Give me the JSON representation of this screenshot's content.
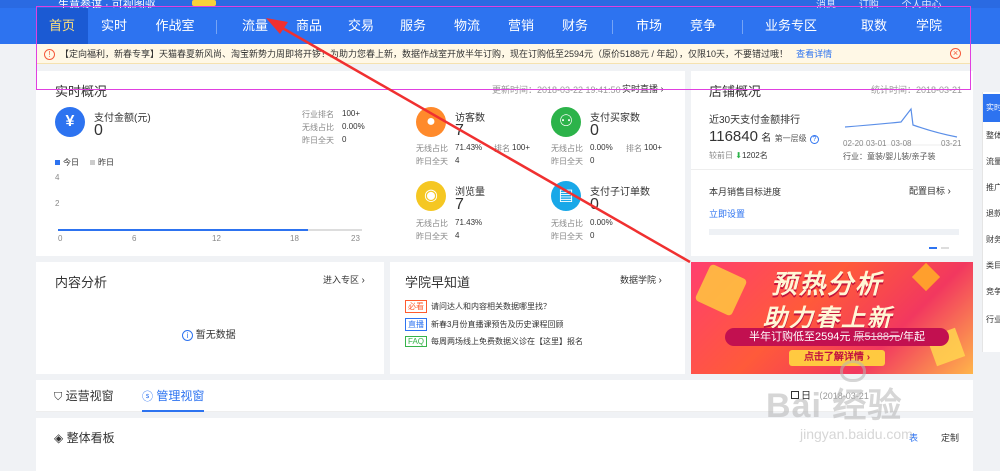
{
  "header": {
    "title_fragment": "生意参谋 · 可视图驱",
    "top_right": [
      "消息",
      "订购",
      "个人中心"
    ],
    "nav": [
      {
        "label": "首页",
        "active": true
      },
      {
        "label": "实时"
      },
      {
        "label": "作战室"
      },
      {
        "label": "流量"
      },
      {
        "label": "商品"
      },
      {
        "label": "交易"
      },
      {
        "label": "服务"
      },
      {
        "label": "物流"
      },
      {
        "label": "营销"
      },
      {
        "label": "财务"
      },
      {
        "label": "市场"
      },
      {
        "label": "竞争"
      },
      {
        "label": "业务专区"
      },
      {
        "label": "取数"
      },
      {
        "label": "学院"
      }
    ]
  },
  "notice": {
    "text": "【定向福利，新春专享】天猫春夏新风尚、淘宝新势力周即将开锣！为助力您春上新，数据作战室开放半年订购，现在订购低至2594元（原价5188元 / 年起），仅限10天，不要错过哦！",
    "link": "查看详情"
  },
  "realtime": {
    "title": "实时概况",
    "updated": "更新时间：2018-03-22 19:41:50",
    "live_link": "实时直播",
    "pay_amount_label": "支付金额(元)",
    "pay_amount_value": "0",
    "industry_rank_label": "行业排名",
    "industry_rank_value": "100+",
    "wireless_label": "无线占比",
    "wireless_value": "0.00%",
    "yesterday_label": "昨日全天",
    "yesterday_value": "0",
    "legend_today": "今日",
    "legend_yesterday": "昨日",
    "chart_y_ticks": [
      "4",
      "2"
    ],
    "chart_x_ticks": [
      "0",
      "6",
      "12",
      "18",
      "23"
    ],
    "visitors": {
      "label": "访客数",
      "value": "7",
      "wireless_label": "无线占比",
      "wireless": "71.43%",
      "rank_label": "排名",
      "rank": "100+",
      "yesterday_label": "昨日全天",
      "yesterday": "4"
    },
    "buyers": {
      "label": "支付买家数",
      "value": "0",
      "wireless_label": "无线占比",
      "wireless": "0.00%",
      "rank_label": "排名",
      "rank": "100+",
      "yesterday_label": "昨日全天",
      "yesterday": "0"
    },
    "pageviews": {
      "label": "浏览量",
      "value": "7",
      "wireless_label": "无线占比",
      "wireless": "71.43%",
      "yesterday_label": "昨日全天",
      "yesterday": "4"
    },
    "orders": {
      "label": "支付子订单数",
      "value": "0",
      "wireless_label": "无线占比",
      "wireless": "0.00%",
      "yesterday_label": "昨日全天",
      "yesterday": "0"
    }
  },
  "shop": {
    "title": "店铺概况",
    "stat_time": "统计时间：2018-03-21",
    "rank_title": "近30天支付金额排行",
    "rank_value": "116840",
    "rank_unit": "名",
    "tier": "第一层级",
    "compare_label": "较前日",
    "compare_value": "1202名",
    "dates": [
      "02-20",
      "03-01",
      "03-08",
      "03-21"
    ],
    "industry": "行业：童装/婴儿装/亲子装",
    "target_title": "本月销售目标进度",
    "target_config": "配置目标",
    "target_link": "立即设置"
  },
  "content": {
    "title": "内容分析",
    "enter": "进入专区",
    "empty": "暂无数据"
  },
  "academy": {
    "title": "学院早知道",
    "more": "数据学院",
    "items": [
      {
        "tag": "必看",
        "color": "#ff5b2e",
        "text": "请问达人和内容相关数据哪里找？"
      },
      {
        "tag": "直播",
        "color": "#2d73f0",
        "text": "新春3月份直播课预告及历史课程回顾"
      },
      {
        "tag": "FAQ",
        "color": "#36b34a",
        "text": "每周两场线上免费数据义诊在【这里】报名"
      }
    ]
  },
  "banner": {
    "line1": "预热分析",
    "line2": "助力春上新",
    "offer_prefix": "半年订购低至2594元",
    "offer_struck": "原5188元",
    "offer_suffix": "/年起",
    "cta": "点击了解详情"
  },
  "side_tabs": [
    "实时",
    "整体",
    "流量",
    "推广",
    "退款",
    "财务",
    "类目",
    "竞争",
    "行业"
  ],
  "tabs": {
    "ops": "运营视窗",
    "manage": "管理视窗",
    "date_label": "日",
    "date_value": "（2018-03-21"
  },
  "board": {
    "title": "整体看板",
    "table_label": "表",
    "customize": "定制"
  },
  "watermark": {
    "brand": "Bai 经验",
    "url": "jingyan.baidu.com"
  },
  "colors": {
    "primary": "#2d73f0",
    "nav_active_text": "#ffe07a",
    "annotation_arrow": "#f03030",
    "selection_outline": "#e040e0"
  }
}
